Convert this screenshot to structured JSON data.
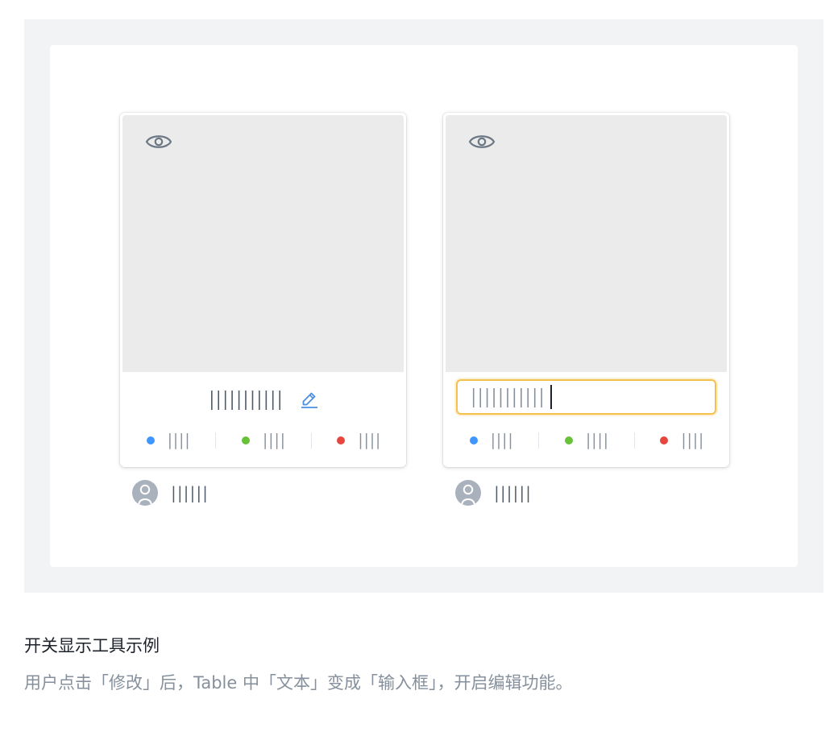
{
  "colors": {
    "stage_bg": "#f2f3f5",
    "preview_bg": "#ebebeb",
    "edit_icon": "#4a90e2",
    "input_focus_border": "#f5c04e",
    "dot_blue": "#4096ff",
    "dot_green": "#67c23a",
    "dot_red": "#e5473e"
  },
  "icons": {
    "preview": "eye-icon",
    "edit": "pencil-icon",
    "avatar": "user-avatar-icon"
  },
  "cards": [
    {
      "mode": "view",
      "title_text": "|||||||||||",
      "statuses": [
        {
          "color": "blue",
          "label": "||||"
        },
        {
          "color": "green",
          "label": "||||"
        },
        {
          "color": "red",
          "label": "||||"
        }
      ],
      "owner_name": "||||||"
    },
    {
      "mode": "edit",
      "input_value": "|||||||||||",
      "statuses": [
        {
          "color": "blue",
          "label": "||||"
        },
        {
          "color": "green",
          "label": "||||"
        },
        {
          "color": "red",
          "label": "||||"
        }
      ],
      "owner_name": "||||||"
    }
  ],
  "caption": {
    "title": "开关显示工具示例",
    "description": "用户点击「修改」后，Table 中「文本」变成「输入框」，开启编辑功能。"
  }
}
